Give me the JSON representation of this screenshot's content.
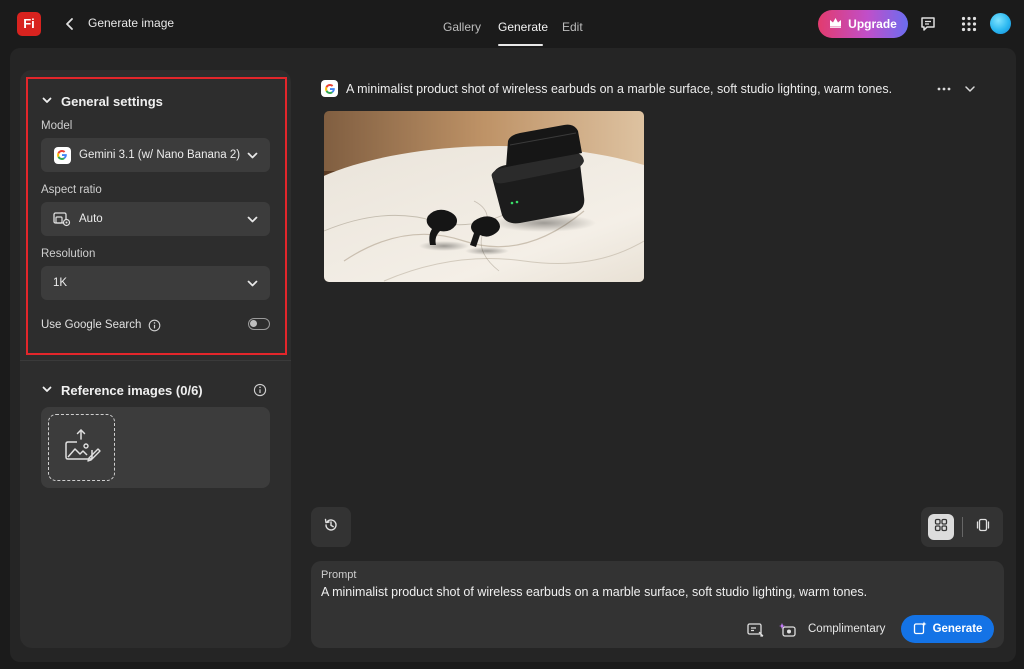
{
  "app": {
    "logo_text": "Fi",
    "page_title": "Generate image"
  },
  "nav": {
    "gallery": "Gallery",
    "generate": "Generate",
    "edit": "Edit",
    "active": "Generate"
  },
  "header": {
    "upgrade_label": "Upgrade"
  },
  "general_settings": {
    "title": "General settings",
    "model_label": "Model",
    "model_value": "Gemini 3.1 (w/ Nano Banana 2)",
    "aspect_label": "Aspect ratio",
    "aspect_value": "Auto",
    "resolution_label": "Resolution",
    "resolution_value": "1K",
    "google_search_label": "Use Google Search",
    "google_search_enabled": false
  },
  "reference_images": {
    "title": "Reference images (0/6)"
  },
  "result": {
    "prompt": "A minimalist product shot of wireless earbuds on a marble surface, soft studio lighting, warm tones."
  },
  "prompt_box": {
    "label": "Prompt",
    "text": "A minimalist product shot of wireless earbuds on a marble surface, soft studio lighting, warm tones.",
    "credits_label": "Complimentary",
    "generate_label": "Generate"
  },
  "colors": {
    "accent": "#1473e6",
    "highlight": "#e3262b",
    "brand": "#d8231f"
  }
}
